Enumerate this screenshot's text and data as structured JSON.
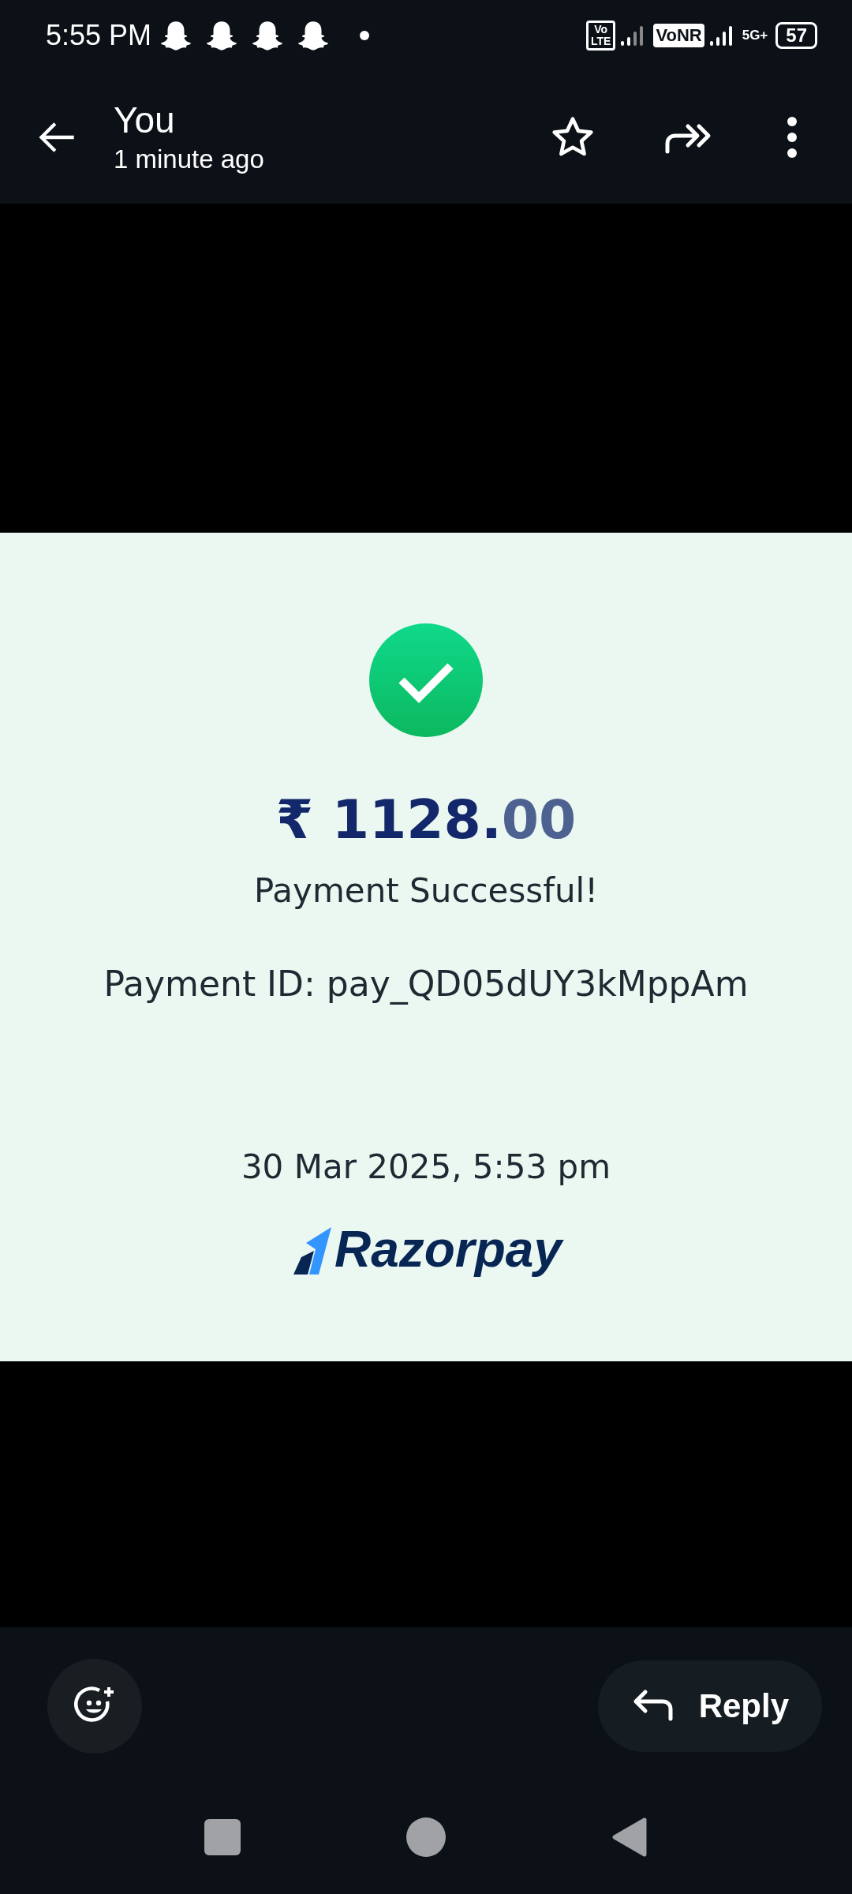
{
  "status_bar": {
    "time": "5:55 PM",
    "notification_icons": [
      {
        "kind": "ghost"
      },
      {
        "kind": "ghost"
      },
      {
        "kind": "ghost"
      },
      {
        "kind": "ghost"
      },
      {
        "kind": "dot"
      }
    ],
    "volte_badge": [
      "Vo",
      "LTE"
    ],
    "vonr_badge": "VoNR",
    "network_type": "5G+",
    "battery": "57"
  },
  "header": {
    "title": "You",
    "subtitle": "1 minute ago"
  },
  "receipt": {
    "amount_main": "₹ 1128.",
    "amount_decimals": "00",
    "status": "Payment Successful!",
    "payment_id": "Payment ID: pay_QD05dUY3kMppAm",
    "date": "30 Mar 2025, 5:53 pm",
    "brand": "Razorpay"
  },
  "reply_button": "Reply"
}
